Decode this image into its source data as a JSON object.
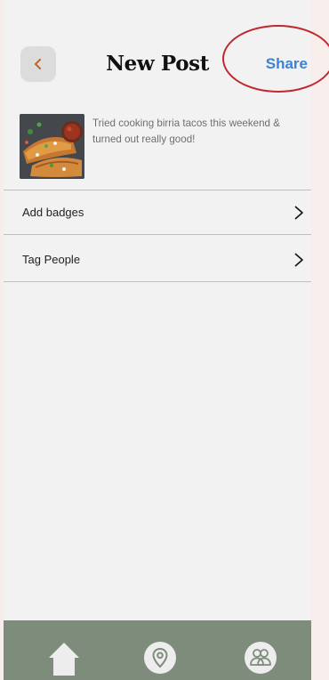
{
  "header": {
    "title": "New Post",
    "share_label": "Share",
    "back_icon": "chevron-left-icon"
  },
  "post": {
    "caption": "Tried cooking birria tacos this weekend & turned out really good!"
  },
  "options": [
    {
      "label": "Add badges",
      "icon": "chevron-right-icon"
    },
    {
      "label": "Tag People",
      "icon": "chevron-right-icon"
    }
  ],
  "bottom_nav": {
    "items": [
      "home-icon",
      "map-pin-icon",
      "people-icon"
    ]
  },
  "colors": {
    "accent_blue": "#3b82d6",
    "back_chevron": "#c06a2a",
    "nav_bar": "#7e8d7b",
    "annotation_ring": "#c0282f"
  }
}
